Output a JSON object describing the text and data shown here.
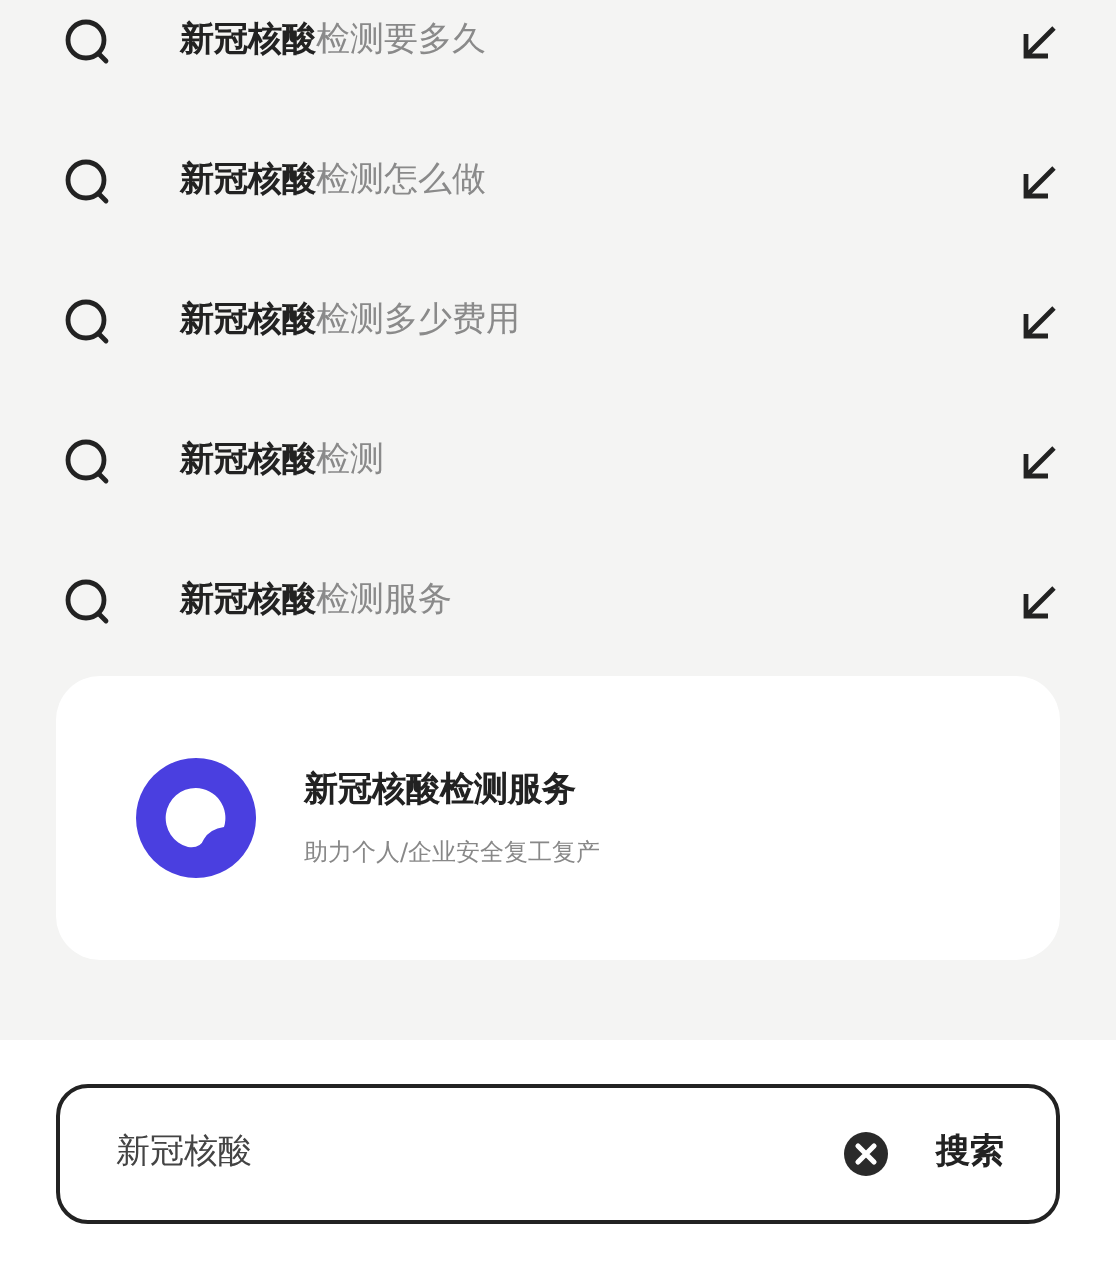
{
  "suggestions": [
    {
      "text": "**新冠核酸**检测要多久"
    },
    {
      "text": "**新冠核酸**检测怎么做"
    },
    {
      "text": "**新冠核酸**检测多少费用"
    },
    {
      "text": "**新冠核酸**检测"
    },
    {
      "text": "**新冠核酸**检测服务"
    }
  ],
  "service_card": {
    "title": "新冠核酸检测服务",
    "subtitle": "助力个人/企业安全复工复产"
  },
  "search_bar": {
    "value": "新冠核酸",
    "button": "搜索"
  }
}
